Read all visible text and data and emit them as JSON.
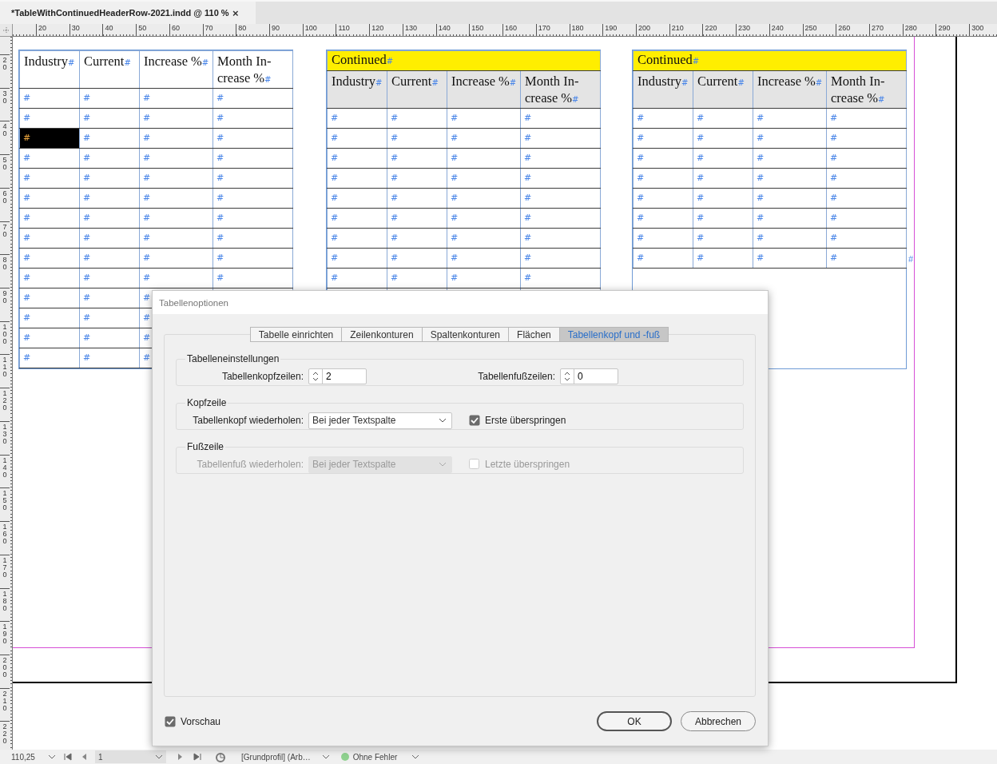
{
  "document_tab": {
    "title": "*TableWithContinuedHeaderRow-2021.indd @ 110 %",
    "close": "×",
    "selected": true
  },
  "rulers": {
    "horizontal": [
      "20",
      "30",
      "40",
      "50",
      "60",
      "70",
      "80",
      "90",
      "100",
      "110",
      "120",
      "130",
      "140",
      "150",
      "160",
      "170",
      "180",
      "190",
      "200",
      "210",
      "220",
      "230",
      "240",
      "250",
      "260",
      "270",
      "280",
      "290",
      "300"
    ],
    "vertical": [
      "20",
      "30",
      "40",
      "50",
      "60",
      "70",
      "80",
      "90",
      "100",
      "110",
      "120",
      "130",
      "140",
      "150",
      "160",
      "170",
      "180",
      "190",
      "200",
      "210",
      "220"
    ]
  },
  "tables": [
    {
      "header_repeated": false,
      "header": [
        {
          "text": "Industry",
          "marker": "#"
        },
        {
          "text": "Current",
          "marker": "#"
        },
        {
          "text": "Increase %",
          "marker": "#"
        },
        {
          "text": "Month In-crease %",
          "marker": "#"
        }
      ],
      "rows": [
        [
          {
            "text": "#",
            "selected": false
          },
          {
            "text": "#",
            "selected": false
          },
          {
            "text": "#",
            "selected": false
          },
          {
            "text": "#",
            "selected": false
          }
        ],
        [
          {
            "text": "#",
            "selected": false
          },
          {
            "text": "#",
            "selected": false
          },
          {
            "text": "#",
            "selected": false
          },
          {
            "text": "#",
            "selected": false
          }
        ],
        [
          {
            "text": "#",
            "selected": true
          },
          {
            "text": "#",
            "selected": false
          },
          {
            "text": "#",
            "selected": false
          },
          {
            "text": "#",
            "selected": false
          }
        ],
        [
          {
            "text": "#",
            "selected": false
          },
          {
            "text": "#",
            "selected": false
          },
          {
            "text": "#",
            "selected": false
          },
          {
            "text": "#",
            "selected": false
          }
        ],
        [
          {
            "text": "#",
            "selected": false
          },
          {
            "text": "#",
            "selected": false
          },
          {
            "text": "#",
            "selected": false
          },
          {
            "text": "#",
            "selected": false
          }
        ],
        [
          {
            "text": "#",
            "selected": false
          },
          {
            "text": "#",
            "selected": false
          },
          {
            "text": "#",
            "selected": false
          },
          {
            "text": "#",
            "selected": false
          }
        ],
        [
          {
            "text": "#",
            "selected": false
          },
          {
            "text": "#",
            "selected": false
          },
          {
            "text": "#",
            "selected": false
          },
          {
            "text": "#",
            "selected": false
          }
        ],
        [
          {
            "text": "#",
            "selected": false
          },
          {
            "text": "#",
            "selected": false
          },
          {
            "text": "#",
            "selected": false
          },
          {
            "text": "#",
            "selected": false
          }
        ],
        [
          {
            "text": "#",
            "selected": false
          },
          {
            "text": "#",
            "selected": false
          },
          {
            "text": "#",
            "selected": false
          },
          {
            "text": "#",
            "selected": false
          }
        ],
        [
          {
            "text": "#",
            "selected": false
          },
          {
            "text": "#",
            "selected": false
          },
          {
            "text": "#",
            "selected": false
          },
          {
            "text": "#",
            "selected": false
          }
        ],
        [
          {
            "text": "#",
            "selected": false
          },
          {
            "text": "#",
            "selected": false
          },
          {
            "text": "#",
            "selected": false
          },
          null
        ],
        [
          {
            "text": "#",
            "selected": false
          },
          {
            "text": "#",
            "selected": false
          },
          {
            "text": "#",
            "selected": false
          },
          null
        ],
        [
          {
            "text": "#",
            "selected": false
          },
          {
            "text": "#",
            "selected": false
          },
          {
            "text": "#",
            "selected": false
          },
          null
        ],
        [
          {
            "text": "#",
            "selected": false
          },
          {
            "text": "#",
            "selected": false
          },
          {
            "text": "#",
            "selected": false
          },
          null
        ]
      ]
    },
    {
      "header_repeated": true,
      "title": {
        "text": "Continued",
        "marker": "#"
      },
      "header": [
        {
          "text": "Industry",
          "marker": "#"
        },
        {
          "text": "Current",
          "marker": "#"
        },
        {
          "text": "Increase %",
          "marker": "#"
        },
        {
          "text": "Month In-crease %",
          "marker": "#"
        }
      ],
      "rows": [
        [
          {
            "text": "#",
            "selected": false
          },
          {
            "text": "#",
            "selected": false
          },
          {
            "text": "#",
            "selected": false
          },
          {
            "text": "#",
            "selected": false
          }
        ],
        [
          {
            "text": "#",
            "selected": false
          },
          {
            "text": "#",
            "selected": false
          },
          {
            "text": "#",
            "selected": false
          },
          {
            "text": "#",
            "selected": false
          }
        ],
        [
          {
            "text": "#",
            "selected": false
          },
          {
            "text": "#",
            "selected": false
          },
          {
            "text": "#",
            "selected": false
          },
          {
            "text": "#",
            "selected": false
          }
        ],
        [
          {
            "text": "#",
            "selected": false
          },
          {
            "text": "#",
            "selected": false
          },
          {
            "text": "#",
            "selected": false
          },
          {
            "text": "#",
            "selected": false
          }
        ],
        [
          {
            "text": "#",
            "selected": false
          },
          {
            "text": "#",
            "selected": false
          },
          {
            "text": "#",
            "selected": false
          },
          {
            "text": "#",
            "selected": false
          }
        ],
        [
          {
            "text": "#",
            "selected": false
          },
          {
            "text": "#",
            "selected": false
          },
          {
            "text": "#",
            "selected": false
          },
          {
            "text": "#",
            "selected": false
          }
        ],
        [
          {
            "text": "#",
            "selected": false
          },
          {
            "text": "#",
            "selected": false
          },
          {
            "text": "#",
            "selected": false
          },
          {
            "text": "#",
            "selected": false
          }
        ],
        [
          {
            "text": "#",
            "selected": false
          },
          {
            "text": "#",
            "selected": false
          },
          {
            "text": "#",
            "selected": false
          },
          {
            "text": "#",
            "selected": false
          }
        ],
        [
          {
            "text": "#",
            "selected": false
          },
          {
            "text": "#",
            "selected": false
          },
          {
            "text": "#",
            "selected": false
          },
          {
            "text": "#",
            "selected": false
          }
        ],
        [
          null,
          null,
          null,
          null
        ]
      ]
    },
    {
      "header_repeated": true,
      "title": {
        "text": "Continued",
        "marker": "#"
      },
      "header": [
        {
          "text": "Industry",
          "marker": "#"
        },
        {
          "text": "Current",
          "marker": "#"
        },
        {
          "text": "Increase %",
          "marker": "#"
        },
        {
          "text": "Month In-crease %",
          "marker": "#"
        }
      ],
      "rows": [
        [
          {
            "text": "#",
            "selected": false
          },
          {
            "text": "#",
            "selected": false
          },
          {
            "text": "#",
            "selected": false
          },
          {
            "text": "#",
            "selected": false
          }
        ],
        [
          {
            "text": "#",
            "selected": false
          },
          {
            "text": "#",
            "selected": false
          },
          {
            "text": "#",
            "selected": false
          },
          {
            "text": "#",
            "selected": false
          }
        ],
        [
          {
            "text": "#",
            "selected": false
          },
          {
            "text": "#",
            "selected": false
          },
          {
            "text": "#",
            "selected": false
          },
          {
            "text": "#",
            "selected": false
          }
        ],
        [
          {
            "text": "#",
            "selected": false
          },
          {
            "text": "#",
            "selected": false
          },
          {
            "text": "#",
            "selected": false
          },
          {
            "text": "#",
            "selected": false
          }
        ],
        [
          {
            "text": "#",
            "selected": false
          },
          {
            "text": "#",
            "selected": false
          },
          {
            "text": "#",
            "selected": false
          },
          {
            "text": "#",
            "selected": false
          }
        ],
        [
          {
            "text": "#",
            "selected": false
          },
          {
            "text": "#",
            "selected": false
          },
          {
            "text": "#",
            "selected": false
          },
          {
            "text": "#",
            "selected": false
          }
        ],
        [
          {
            "text": "#",
            "selected": false
          },
          {
            "text": "#",
            "selected": false
          },
          {
            "text": "#",
            "selected": false
          },
          {
            "text": "#",
            "selected": false
          }
        ],
        [
          {
            "text": "#",
            "selected": false
          },
          {
            "text": "#",
            "selected": false
          },
          {
            "text": "#",
            "selected": false
          },
          {
            "text": "#",
            "selected": false
          }
        ]
      ],
      "end_marker": "#"
    }
  ],
  "dialog": {
    "title": "Tabellenoptionen",
    "tabs": [
      {
        "label": "Tabelle einrichten",
        "selected": false
      },
      {
        "label": "Zeilenkonturen",
        "selected": false
      },
      {
        "label": "Spaltenkonturen",
        "selected": false
      },
      {
        "label": "Flächen",
        "selected": false
      },
      {
        "label": "Tabellenkopf und -fuß",
        "selected": true
      }
    ],
    "groups": [
      {
        "title": "Tabelleneinstellungen",
        "controls": [
          {
            "kind": "spinner",
            "label": "Tabellenkopfzeilen:",
            "value": "2"
          },
          {
            "kind": "spinner",
            "label": "Tabellenfußzeilen:",
            "value": "0"
          }
        ]
      },
      {
        "title": "Kopfzeile",
        "controls": [
          {
            "kind": "dropdown",
            "label": "Tabellenkopf wiederholen:",
            "value": "Bei jeder Textspalte",
            "disabled": false
          },
          {
            "kind": "checkbox",
            "label": "Erste überspringen",
            "checked": true,
            "disabled": false
          }
        ]
      },
      {
        "title": "Fußzeile",
        "controls": [
          {
            "kind": "dropdown",
            "label": "Tabellenfuß wiederholen:",
            "value": "Bei jeder Textspalte",
            "disabled": true
          },
          {
            "kind": "checkbox",
            "label": "Letzte überspringen",
            "checked": false,
            "disabled": true
          }
        ]
      }
    ],
    "preview": {
      "label": "Vorschau",
      "checked": true
    },
    "buttons": [
      {
        "label": "OK",
        "default": true
      },
      {
        "label": "Abbrechen",
        "default": false
      }
    ]
  },
  "status_bar": {
    "zoom": "110,25",
    "page": "1",
    "profile": "[Grundprofil] (Arb…",
    "preflight": {
      "text": "Ohne Fehler",
      "color": "#8fd18f"
    }
  }
}
